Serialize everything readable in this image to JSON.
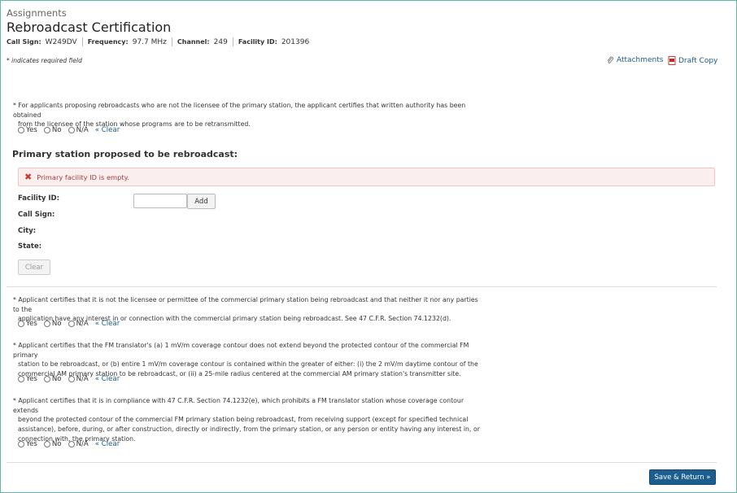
{
  "header": {
    "breadcrumb": "Assignments",
    "title": "Rebroadcast Certification",
    "call_sign_label": "Call Sign:",
    "call_sign": "W249DV",
    "frequency_label": "Frequency:",
    "frequency": "97.7 MHz",
    "channel_label": "Channel:",
    "channel": "249",
    "facility_id_label": "Facility ID:",
    "facility_id": "201396"
  },
  "required_note": "* indicates required field",
  "top_links": {
    "attachments": "Attachments",
    "draft_copy": "Draft Copy"
  },
  "radio_labels": {
    "yes": "Yes",
    "no": "No",
    "na": "N/A",
    "clear": "« Clear"
  },
  "questions": [
    {
      "lines": [
        "* For applicants proposing rebroadcasts who are not the licensee of the primary station, the applicant certifies that written authority has been obtained",
        "from the licensee of the station whose programs are to be retransmitted."
      ]
    },
    {
      "lines": [
        "* Applicant certifies that it is not the licensee or permittee of the commercial primary station being rebroadcast and that neither it nor any parties to the",
        "application have any interest in or connection with the commercial primary station being rebroadcast. See 47 C.F.R. Section 74.1232(d)."
      ]
    },
    {
      "lines": [
        "* Applicant certifies that the FM translator's (a) 1 mV/m coverage contour does not extend beyond the protected contour of the commercial FM primary",
        "station to be rebroadcast, or (b) entire 1 mV/m coverage contour is contained within the greater of either: (i) the 2 mV/m daytime contour of the",
        "commercial AM primary station to be rebroadcast, or (ii) a 25-mile radius centered at the commercial AM primary station's transmitter site."
      ]
    },
    {
      "lines": [
        "* Applicant certifies that it is in compliance with 47 C.F.R. Section 74.1232(e), which prohibits a FM translator station whose coverage contour extends",
        "beyond the protected contour of the commercial FM primary station being rebroadcast, from receiving support (except for specified technical",
        "assistance), before, during, or after construction, directly or indirectly, from the primary station, or any person or entity having any interest in, or",
        "connection with, the primary station."
      ]
    }
  ],
  "primary_station": {
    "heading": "Primary station proposed to be rebroadcast:",
    "error": "Primary facility ID is empty.",
    "facility_id_label": "Facility ID:",
    "call_sign_label": "Call Sign:",
    "city_label": "City:",
    "state_label": "State:",
    "facility_input_value": "",
    "add_label": "Add",
    "clear_label": "Clear"
  },
  "footer": {
    "save_return": "Save & Return »"
  },
  "colors": {
    "link": "#1b5c8a",
    "primary_button": "#1c5e8f",
    "error_bg": "#fbeeee",
    "error_text": "#a13c3c",
    "frame": "#5bb9a8"
  }
}
